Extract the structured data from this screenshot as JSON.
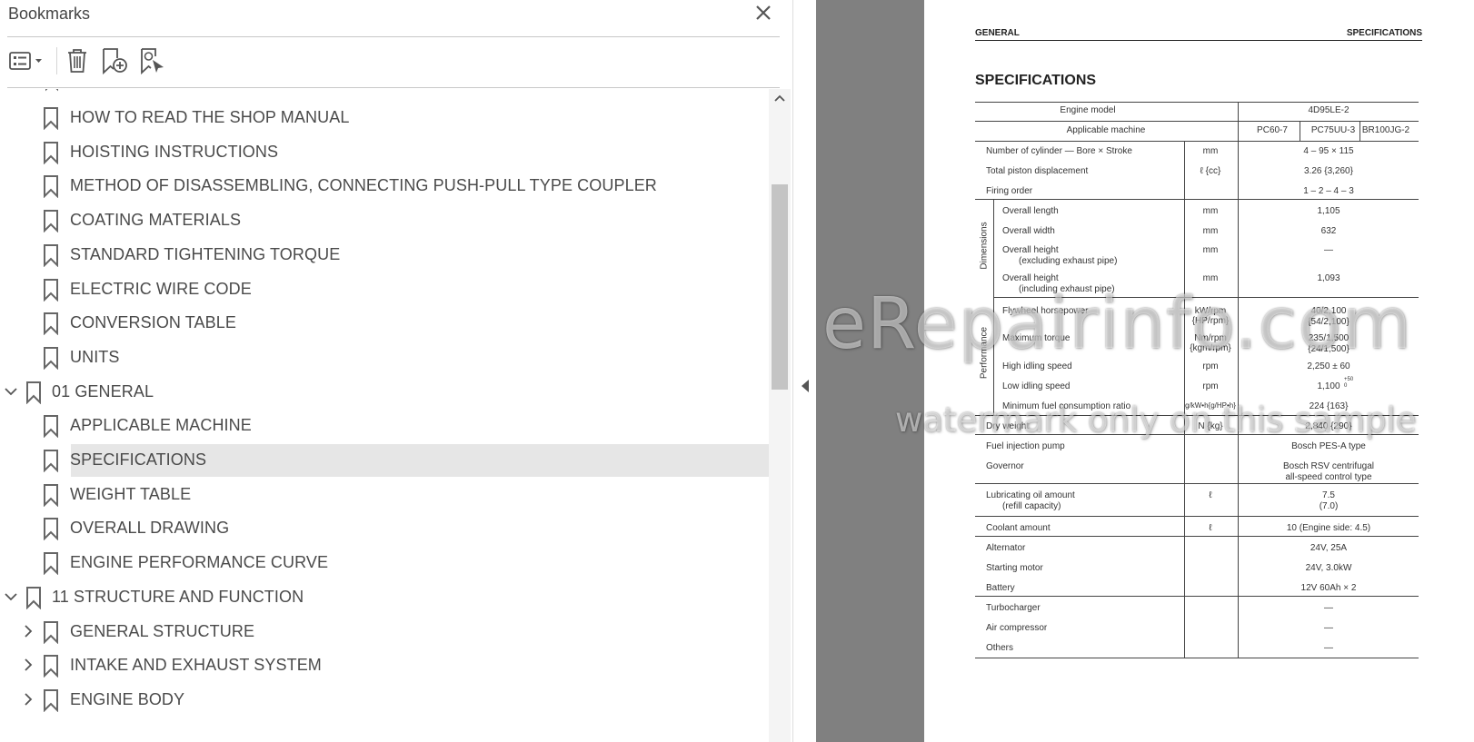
{
  "panel": {
    "title": "Bookmarks",
    "toolbar": {
      "options_icon": "options-menu-icon",
      "delete_icon": "trash-icon",
      "new_bookmark_icon": "new-bookmark-icon",
      "find_bookmark_icon": "find-current-bookmark-icon"
    },
    "items": [
      {
        "label": "HOW TO READ THE SHOP MANUAL",
        "level": 1,
        "expander": "none",
        "selected": false
      },
      {
        "label": "HOISTING INSTRUCTIONS",
        "level": 1,
        "expander": "none",
        "selected": false
      },
      {
        "label": "METHOD OF DISASSEMBLING, CONNECTING PUSH-PULL TYPE COUPLER",
        "level": 1,
        "expander": "none",
        "selected": false
      },
      {
        "label": "COATING MATERIALS",
        "level": 1,
        "expander": "none",
        "selected": false
      },
      {
        "label": "STANDARD TIGHTENING TORQUE",
        "level": 1,
        "expander": "none",
        "selected": false
      },
      {
        "label": "ELECTRIC WIRE CODE",
        "level": 1,
        "expander": "none",
        "selected": false
      },
      {
        "label": "CONVERSION TABLE",
        "level": 1,
        "expander": "none",
        "selected": false
      },
      {
        "label": "UNITS",
        "level": 1,
        "expander": "none",
        "selected": false
      },
      {
        "label": "01 GENERAL",
        "level": 0,
        "expander": "expanded",
        "selected": false
      },
      {
        "label": "APPLICABLE MACHINE",
        "level": 1,
        "expander": "none",
        "selected": false
      },
      {
        "label": "SPECIFICATIONS",
        "level": 1,
        "expander": "none",
        "selected": true
      },
      {
        "label": "WEIGHT TABLE",
        "level": 1,
        "expander": "none",
        "selected": false
      },
      {
        "label": "OVERALL DRAWING",
        "level": 1,
        "expander": "none",
        "selected": false
      },
      {
        "label": "ENGINE PERFORMANCE CURVE",
        "level": 1,
        "expander": "none",
        "selected": false
      },
      {
        "label": "11 STRUCTURE AND FUNCTION",
        "level": 0,
        "expander": "expanded",
        "selected": false
      },
      {
        "label": "GENERAL STRUCTURE",
        "level": 1,
        "expander": "collapsed",
        "selected": false
      },
      {
        "label": "INTAKE AND EXHAUST SYSTEM",
        "level": 1,
        "expander": "collapsed",
        "selected": false
      },
      {
        "label": "ENGINE BODY",
        "level": 1,
        "expander": "collapsed",
        "selected": false
      }
    ]
  },
  "page": {
    "header_left": "GENERAL",
    "header_right": "SPECIFICATIONS",
    "title": "SPECIFICATIONS",
    "table": {
      "engine_model_label": "Engine model",
      "engine_model_value": "4D95LE-2",
      "applicable_label": "Applicable machine",
      "machines": [
        "PC60-7",
        "PC75UU-3",
        "BR100JG-2"
      ],
      "dimensions_group": "Dimensions",
      "performance_group": "Performance",
      "rows": [
        {
          "item": "Number of cylinder — Bore × Stroke",
          "unit": "mm",
          "value": "4 – 95 × 115"
        },
        {
          "item": "Total piston displacement",
          "unit": "ℓ {cc}",
          "value": "3.26 {3,260}"
        },
        {
          "item": "Firing order",
          "unit": "",
          "value": "1 – 2 – 4 – 3"
        },
        {
          "item": "Overall length",
          "unit": "mm",
          "value": "1,105"
        },
        {
          "item": "Overall width",
          "unit": "mm",
          "value": "632"
        },
        {
          "item": "Overall height",
          "item2": "(excluding exhaust pipe)",
          "unit": "mm",
          "value": "—"
        },
        {
          "item": "Overall height",
          "item2": "(including exhaust pipe)",
          "unit": "mm",
          "value": "1,093"
        },
        {
          "item": "Flywheel horsepower",
          "unit": "kW/rpm",
          "unit2": "{HP/rpm}",
          "value": "40/2,100",
          "value2": "{54/2,100}"
        },
        {
          "item": "Maximum torque",
          "unit": "Nm/rpm",
          "unit2": "{kgm/rpm}",
          "value": "235/1,500",
          "value2": "{24/1,500}"
        },
        {
          "item": "High idling speed",
          "unit": "rpm",
          "value": "2,250 ± 60"
        },
        {
          "item": "Low idling speed",
          "unit": "rpm",
          "value": "1,100",
          "value_sup": "+50",
          "value_sub": "0"
        },
        {
          "item": "Minimum fuel consumption ratio",
          "unit": "g/kW•h{g/HP•h}",
          "value": "224 {163}"
        },
        {
          "item": "Dry weight",
          "unit": "N {kg}",
          "value": "2,840 {290}"
        },
        {
          "item": "Fuel injection pump",
          "unit": "",
          "value": "Bosch PES-A type"
        },
        {
          "item": "Governor",
          "unit": "",
          "value": "Bosch RSV centrifugal",
          "value2": "all-speed control type"
        },
        {
          "item": "Lubricating oil amount",
          "item2": "(refill capacity)",
          "unit": "ℓ",
          "value": "7.5",
          "value2": "(7.0)"
        },
        {
          "item": "Coolant amount",
          "unit": "ℓ",
          "value": "10 (Engine side: 4.5)"
        },
        {
          "item": "Alternator",
          "unit": "",
          "value": "24V, 25A"
        },
        {
          "item": "Starting motor",
          "unit": "",
          "value": "24V, 3.0kW"
        },
        {
          "item": "Battery",
          "unit": "",
          "value": "12V 60Ah × 2"
        },
        {
          "item": "Turbocharger",
          "unit": "",
          "value": "—"
        },
        {
          "item": "Air compressor",
          "unit": "",
          "value": "—"
        },
        {
          "item": "Others",
          "unit": "",
          "value": "—"
        }
      ]
    }
  },
  "watermark": {
    "line1": "eRepairinfo.com",
    "line2": "watermark only on this sample"
  }
}
